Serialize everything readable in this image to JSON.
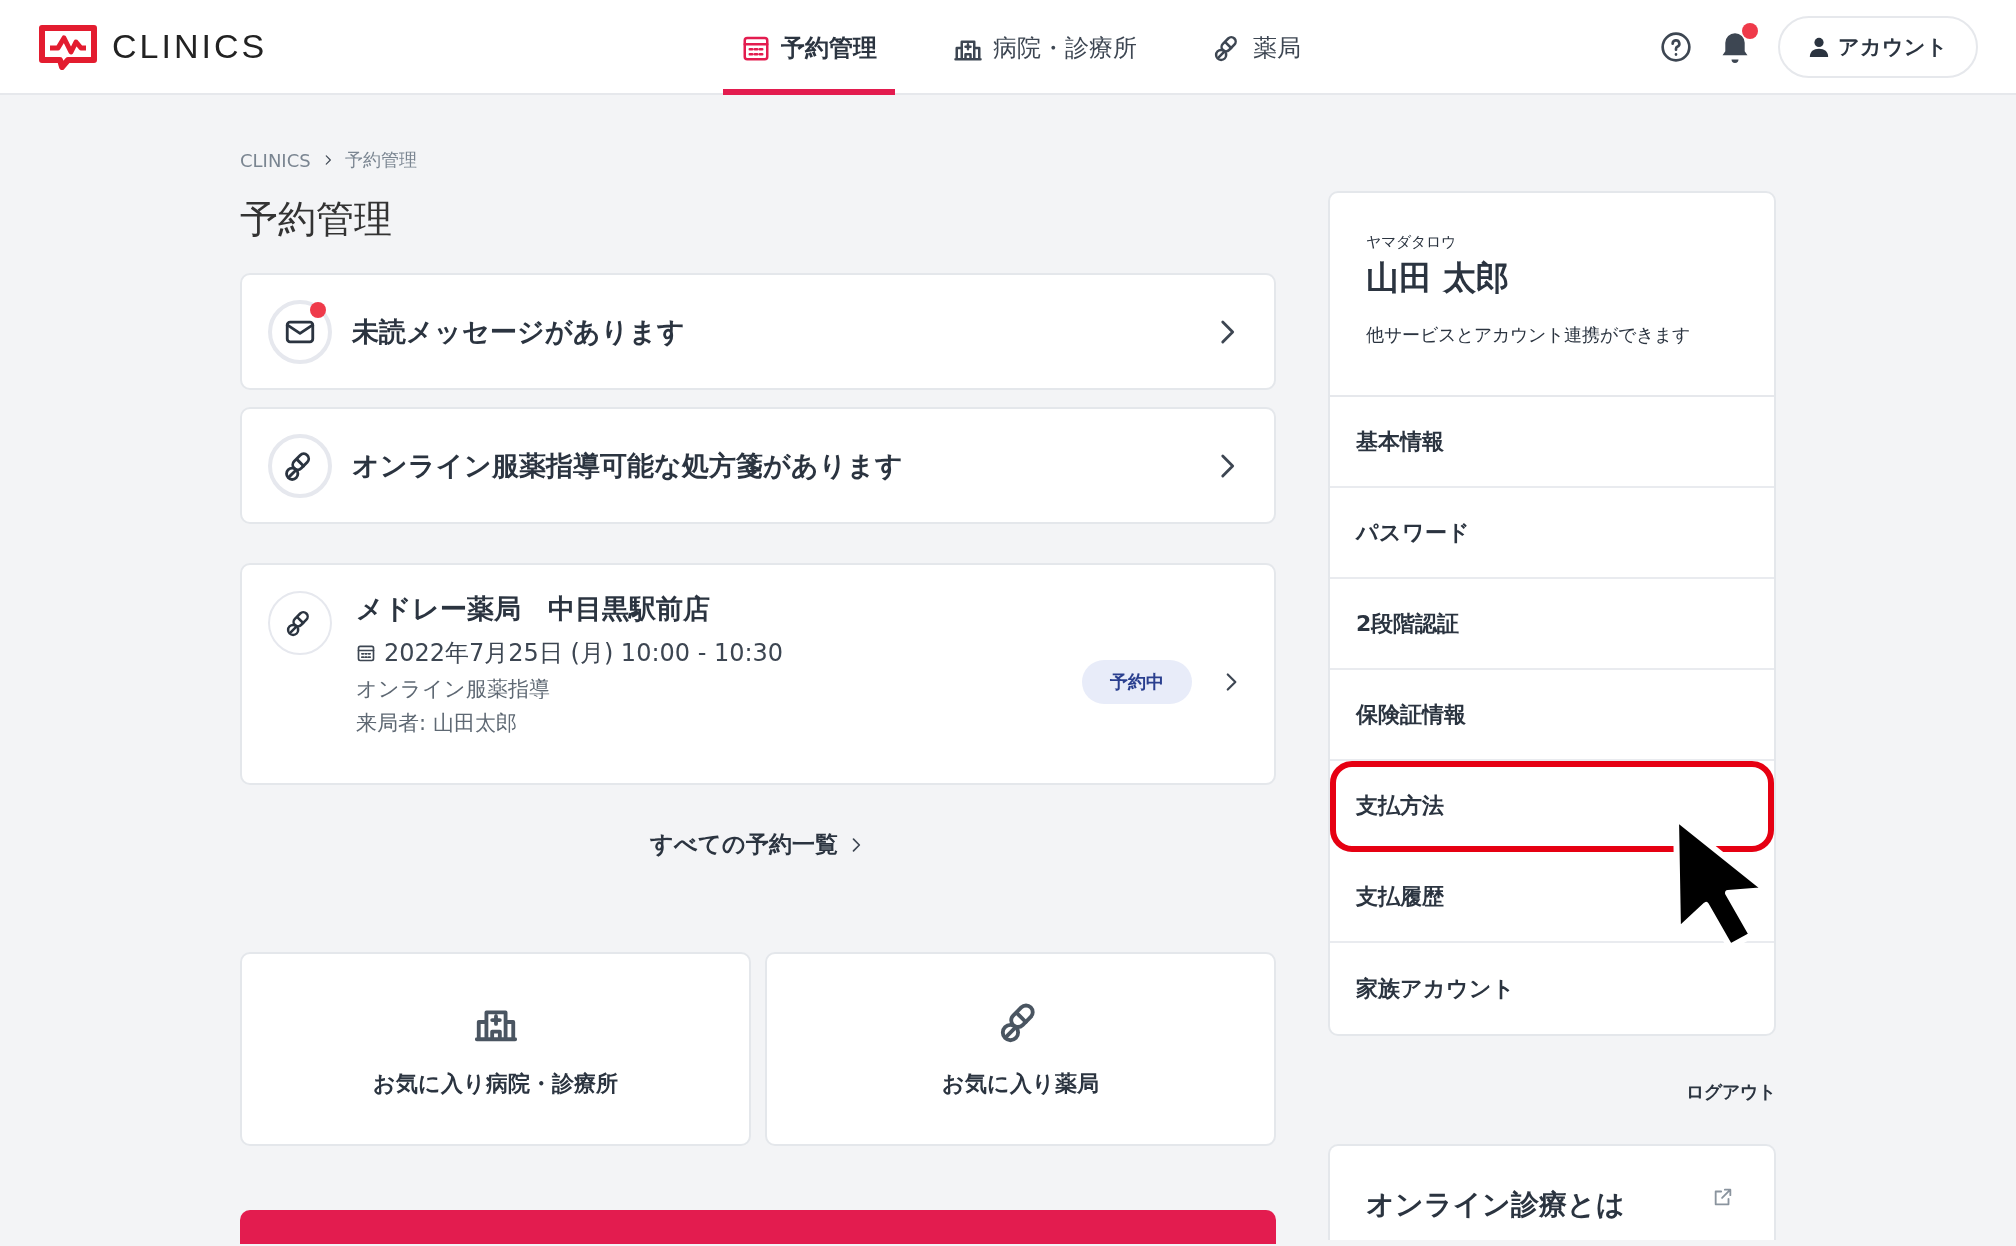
{
  "header": {
    "logo": "CLINICS",
    "nav": [
      {
        "label": "予約管理",
        "kind": "calendar",
        "selected": true
      },
      {
        "label": "病院・診療所",
        "kind": "hospital",
        "selected": false
      },
      {
        "label": "薬局",
        "kind": "pill",
        "selected": false
      }
    ],
    "notification_unread": true,
    "account_button": "アカウント"
  },
  "breadcrumb": [
    "CLINICS",
    "予約管理"
  ],
  "page_title": "予約管理",
  "notices": [
    {
      "kind": "mail",
      "text": "未読メッセージがあります",
      "unread": true
    },
    {
      "kind": "pill",
      "text": "オンライン服薬指導可能な処方箋があります",
      "unread": false
    }
  ],
  "appointment": {
    "pharmacy": "メドレー薬局　中目黒駅前店",
    "datetime": "2022年7月25日 (月) 10:00 - 10:30",
    "type": "オンライン服薬指導",
    "visitor": "来局者: 山田太郎",
    "status": "予約中"
  },
  "all_link": "すべての予約一覧",
  "favorites": [
    {
      "kind": "hospital",
      "label": "お気に入り病院・診療所"
    },
    {
      "kind": "pill",
      "label": "お気に入り薬局"
    }
  ],
  "profile": {
    "kana": "ヤマダタロウ",
    "name": "山田 太郎",
    "note": "他サービスとアカウント連携ができます"
  },
  "menu": [
    {
      "label": "基本情報",
      "highlighted": false
    },
    {
      "label": "パスワード",
      "highlighted": false
    },
    {
      "label": "2段階認証",
      "highlighted": false
    },
    {
      "label": "保険証情報",
      "highlighted": false
    },
    {
      "label": "支払方法",
      "highlighted": true
    },
    {
      "label": "支払履歴",
      "highlighted": false
    },
    {
      "label": "家族アカウント",
      "highlighted": false
    }
  ],
  "logout": "ログアウト",
  "info_card": {
    "title": "オンライン診療とは"
  }
}
